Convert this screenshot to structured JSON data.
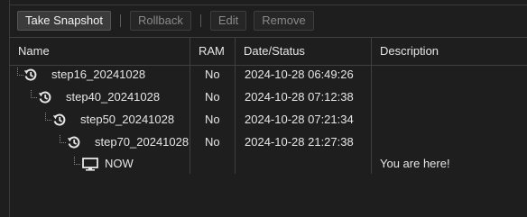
{
  "toolbar": {
    "take_snapshot": "Take Snapshot",
    "rollback": "Rollback",
    "edit": "Edit",
    "remove": "Remove"
  },
  "columns": {
    "name": "Name",
    "ram": "RAM",
    "date_status": "Date/Status",
    "description": "Description"
  },
  "rows": [
    {
      "name": "step16_20241028",
      "ram": "No",
      "date": "2024-10-28 06:49:26",
      "description": "",
      "icon": "snapshot-history-icon"
    },
    {
      "name": "step40_20241028",
      "ram": "No",
      "date": "2024-10-28 07:12:38",
      "description": "",
      "icon": "snapshot-history-icon"
    },
    {
      "name": "step50_20241028",
      "ram": "No",
      "date": "2024-10-28 07:21:34",
      "description": "",
      "icon": "snapshot-history-icon"
    },
    {
      "name": "step70_20241028",
      "ram": "No",
      "date": "2024-10-28 21:27:38",
      "description": "",
      "icon": "snapshot-history-icon"
    },
    {
      "name": "NOW",
      "ram": "",
      "date": "",
      "description": "You are here!",
      "icon": "monitor-icon"
    }
  ]
}
